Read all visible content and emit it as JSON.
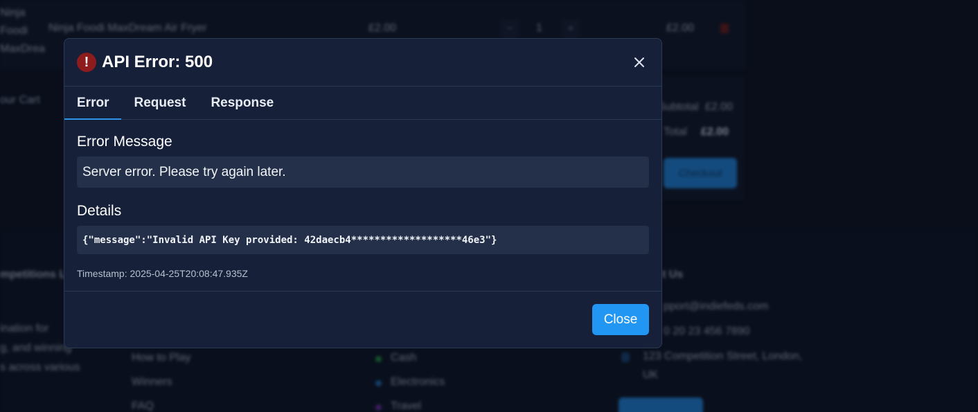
{
  "background": {
    "product_name": "Ninja Foodi MaxDream Air Fryer",
    "product_short": [
      "Ninja",
      "Foodi",
      "MaxDrea"
    ],
    "price": "£2.00",
    "qty": "1",
    "line_total": "£2.00",
    "cart_label": "our Cart",
    "subtotal_label": "Subtotal",
    "subtotal_value": "£2.00",
    "total_label": "Total",
    "total_value": "£2.00",
    "checkout_label": "Checkout",
    "about_heading": "mpetitions Ltd",
    "about_lines": [
      "ination for",
      "g, and winning",
      "s across various"
    ],
    "links": [
      "How to Play",
      "Winners",
      "FAQ"
    ],
    "categories": [
      "Cash",
      "Electronics",
      "Travel"
    ],
    "contact_heading": "t Us",
    "contact_email": "pport@indiefeds.com",
    "contact_phone": "0 20 23 456 7890",
    "contact_address": [
      "123 Competition Street, London,",
      "UK"
    ],
    "colors": {
      "cash": "#1e7a3a",
      "electronics": "#1b5f9a",
      "travel": "#5a2a8a"
    }
  },
  "modal": {
    "title": "API Error: 500",
    "error_icon": "exclamation-icon",
    "close_icon": "close-icon",
    "tabs": [
      {
        "label": "Error",
        "active": true
      },
      {
        "label": "Request",
        "active": false
      },
      {
        "label": "Response",
        "active": false
      }
    ],
    "error_message_label": "Error Message",
    "error_message": "Server error. Please try again later.",
    "details_label": "Details",
    "details": "{\"message\":\"Invalid API Key provided: 42daecb4*******************46e3\"}",
    "timestamp": "Timestamp: 2025-04-25T20:08:47.935Z",
    "close_button": "Close",
    "accent_color": "#2196f3",
    "error_color": "#8e1c1c"
  }
}
